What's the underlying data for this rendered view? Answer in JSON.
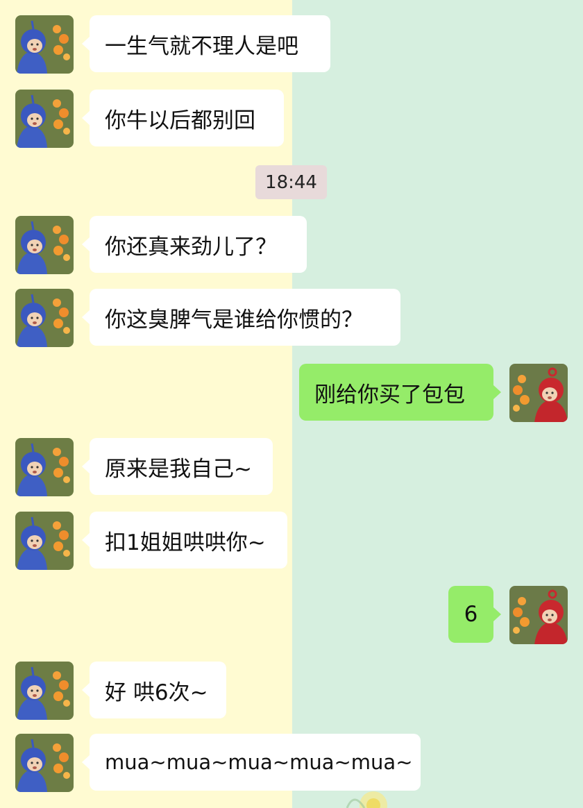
{
  "colors": {
    "left_background": "#fffbd2",
    "right_background": "#d6efdf",
    "incoming_bubble": "#ffffff",
    "outgoing_bubble": "#95ec69",
    "timestamp_bg": "#e8dada"
  },
  "timestamp": "18:44",
  "messages": [
    {
      "side": "left",
      "text": "一生气就不理人是吧",
      "avatar": "blue-teletubby-avatar"
    },
    {
      "side": "left",
      "text": "你牛以后都别回",
      "avatar": "blue-teletubby-avatar"
    },
    {
      "side": "left",
      "text": "你还真来劲儿了？",
      "avatar": "blue-teletubby-avatar"
    },
    {
      "side": "left",
      "text": "你这臭脾气是谁给你惯的？",
      "avatar": "blue-teletubby-avatar"
    },
    {
      "side": "right",
      "text": "刚给你买了包包",
      "avatar": "red-teletubby-avatar"
    },
    {
      "side": "left",
      "text": "原来是我自己~",
      "avatar": "blue-teletubby-avatar"
    },
    {
      "side": "left",
      "text": "扣1姐姐哄哄你~",
      "avatar": "blue-teletubby-avatar"
    },
    {
      "side": "right",
      "text": "6",
      "avatar": "red-teletubby-avatar"
    },
    {
      "side": "left",
      "text": "好 哄6次~",
      "avatar": "blue-teletubby-avatar"
    },
    {
      "side": "left",
      "text": "mua~mua~mua~mua~mua~",
      "avatar": "blue-teletubby-avatar"
    }
  ]
}
